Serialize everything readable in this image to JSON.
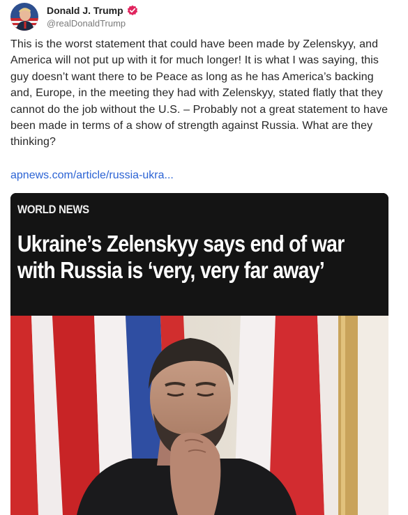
{
  "post": {
    "author_name": "Donald J. Trump",
    "handle": "@realDonaldTrump",
    "verified_icon": "verified-badge-icon",
    "avatar_icon": "user-avatar",
    "text": "This is the worst statement that could have been made by Zelenskyy, and America will not put up with it for much longer! It is what I was saying, this guy doesn’t want there to be Peace as long as he has America’s backing and, Europe, in the meeting they had with Zelenskyy, stated flatly that they cannot do the job without the U.S. – Probably not a great statement to have been made in terms of a show of strength against Russia. What are they thinking?",
    "link_text": "apnews.com/article/russia-ukra..."
  },
  "card": {
    "category": "WORLD NEWS",
    "title": "Ukraine’s Zelenskyy says end of war with Russia is ‘very, very far away’"
  },
  "colors": {
    "link": "#2b63d4",
    "verified": "#e0245e",
    "card_background": "#141414"
  }
}
